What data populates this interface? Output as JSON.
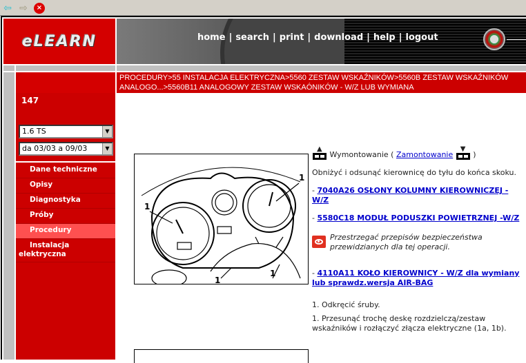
{
  "toolbar": {
    "back_icon": "arrow-left-icon",
    "forward_icon": "arrow-right-icon",
    "stop_icon": "stop-icon"
  },
  "logo": {
    "text": "eLEARN"
  },
  "nav": {
    "items": [
      "home",
      "search",
      "print",
      "download",
      "help",
      "logout"
    ]
  },
  "breadcrumb": {
    "line1": "PROCEDURY>55 INSTALACJA ELEKTRYCZNA>5560 ZESTAW WSKAŹNIKÓW>5560B ZESTAW WSKAŹNIKÓW",
    "line2": "ANALOGO...>5560B11 ANALOGOWY ZESTAW WSKAÓNIKÓW - W/Z LUB WYMIANA"
  },
  "sidebar": {
    "model": "147",
    "engine_select": "1.6 TS",
    "date_select": "da 03/03 a 09/03",
    "menu": [
      {
        "label": "Dane techniczne",
        "active": false
      },
      {
        "label": "Opisy",
        "active": false
      },
      {
        "label": "Diagnostyka",
        "active": false
      },
      {
        "label": "Próby",
        "active": false
      },
      {
        "label": "Procedury",
        "active": true
      },
      {
        "label": "Instalacja elektryczna",
        "active": false
      }
    ]
  },
  "figure": {
    "callouts": [
      "1",
      "1",
      "1",
      "1"
    ]
  },
  "content": {
    "removal_label": "Wymontowanie (",
    "install_link": "Zamontowanie",
    "close_paren": ")",
    "step_intro": "Obniżyć i odsunąć kierownicę do tyłu do końca skoku.",
    "links": [
      "7040A26  OSŁONY KOLUMNY KIEROWNICZEJ - W/Z",
      "5580C18  MODUŁ PODUSZKI POWIETRZNEJ -W/Z",
      "4110A11  KOŁO KIEROWNICY - W/Z dla wymiany lub sprawdz.wersja AIR-BAG"
    ],
    "link_prefix": "- ",
    "warning": "Przestrzegać przepisów bezpieczeństwa przewidzianych dla tej operacji.",
    "step1": "1. Odkręcić śruby.",
    "step2": "1. Przesunąć trochę deskę rozdzielczą/zestaw wskaźników i rozłączyć złącza elektryczne (1a, 1b)."
  },
  "colors": {
    "brand_red": "#cc0000",
    "active_menu": "#ff5050",
    "link": "#0000cc",
    "warning": "#e03020"
  }
}
